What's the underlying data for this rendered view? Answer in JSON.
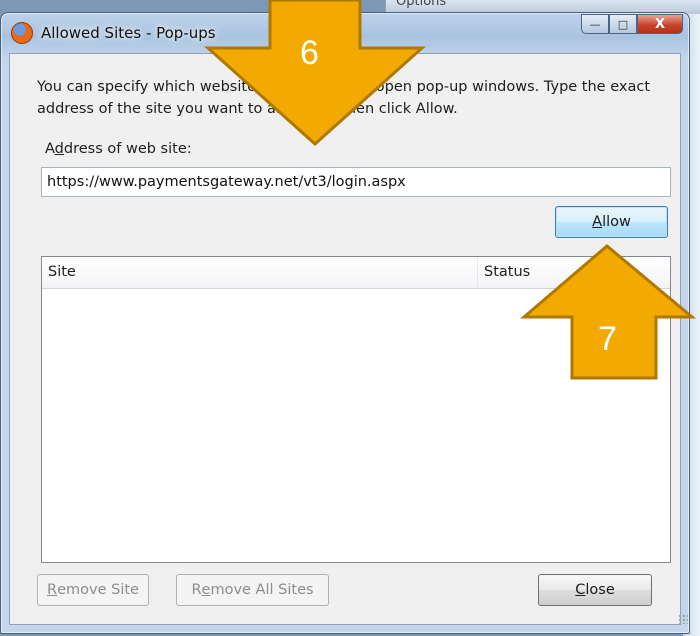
{
  "background": {
    "partial_title": "Options"
  },
  "window": {
    "title": "Allowed Sites - Pop-ups",
    "icon": "firefox-icon",
    "controls": {
      "minimize": "—",
      "maximize": "□",
      "close": "X"
    }
  },
  "dialog": {
    "description": "You can specify which websites are allowed to open pop-up windows. Type the exact address of the site you want to allow and then click Allow.",
    "address_label_pre": "A",
    "address_label_access": "d",
    "address_label_post": "dress of web site:",
    "address_value": "https://www.paymentsgateway.net/vt3/login.aspx",
    "allow_access": "A",
    "allow_rest": "llow",
    "list": {
      "columns": [
        "Site",
        "Status"
      ],
      "rows": []
    },
    "remove_site_access": "R",
    "remove_site_rest": "emove Site",
    "remove_all_pre": "R",
    "remove_all_access": "e",
    "remove_all_post": "move All Sites",
    "close_access": "C",
    "close_rest": "lose"
  },
  "callouts": [
    {
      "number": "6",
      "direction": "down"
    },
    {
      "number": "7",
      "direction": "up"
    }
  ],
  "colors": {
    "callout_fill": "#f2a900",
    "callout_stroke": "#b07800",
    "accent": "#3c7fb1"
  }
}
